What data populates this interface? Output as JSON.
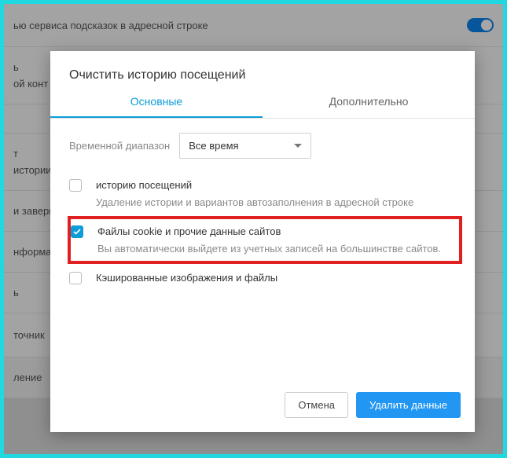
{
  "background": {
    "row1": "ью сервиса подсказок в адресной строке",
    "row2_a": "ь",
    "row2_b": "ой конт",
    "row3_a": "т",
    "row3_b": "истории",
    "row4": "и заверш",
    "row5": "нформац",
    "row6": "ь",
    "row7": "точник",
    "row8": "ление"
  },
  "dialog": {
    "title": "Очистить историю посещений",
    "tabs": {
      "basic": "Основные",
      "advanced": "Дополнительно"
    },
    "range_label": "Временной диапазон",
    "range_value": "Все время",
    "options": [
      {
        "title": "историю посещений",
        "desc": "Удаление истории и вариантов автозаполнения в адресной строке",
        "checked": false
      },
      {
        "title": "Файлы cookie и прочие данные сайтов",
        "desc": "Вы автоматически выйдете из учетных записей на большинстве сайтов.",
        "checked": true
      },
      {
        "title": "Кэшированные изображения и файлы",
        "desc": "",
        "checked": false
      }
    ],
    "cancel": "Отмена",
    "confirm": "Удалить данные"
  }
}
